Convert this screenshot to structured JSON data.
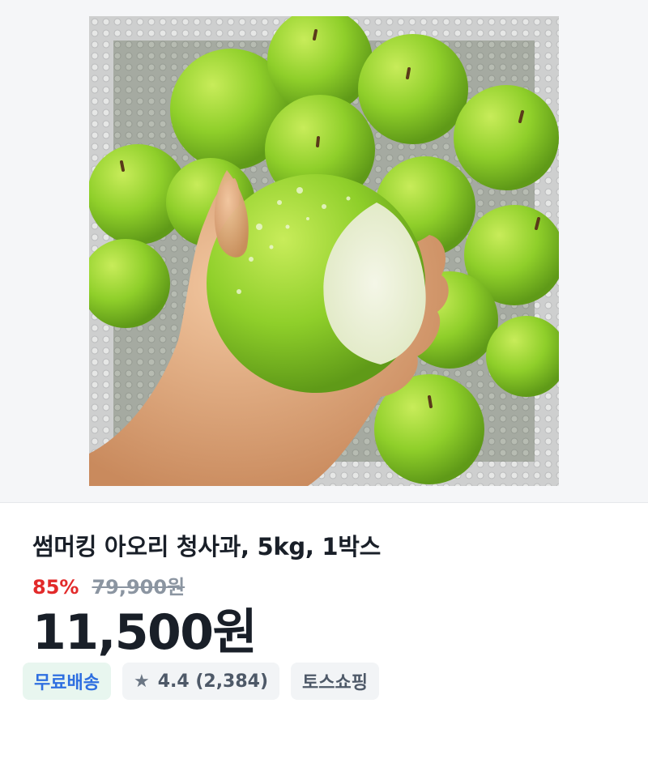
{
  "product": {
    "image_alt": "green apples in box, hand holding a bitten apple",
    "title": "썸머킹 아오리 청사과, 5kg, 1박스",
    "discount": "85%",
    "original_price": "79,900원",
    "sale_price": "11,500원"
  },
  "tags": {
    "free_shipping": "무료배송",
    "rating_icon": "★",
    "rating": "4.4 (2,384)",
    "store": "토스쇼핑"
  }
}
